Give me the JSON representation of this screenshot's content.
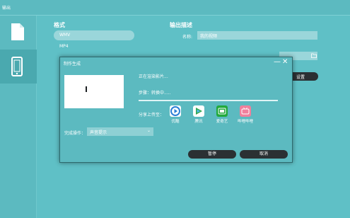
{
  "window": {
    "title": "输出"
  },
  "sidebar": {
    "items": [
      {
        "icon": "document-icon",
        "active": false
      },
      {
        "icon": "phone-icon",
        "active": true
      }
    ]
  },
  "format": {
    "title": "格式",
    "selected": "WMV",
    "options": [
      "WMV",
      "MP4"
    ]
  },
  "description": {
    "title": "输出描述",
    "name_label": "名称:",
    "name_value": "我的视频"
  },
  "settings_button": "设置",
  "dialog": {
    "title": "制作生成",
    "status_rendering": "正在渲染影片...",
    "status_step": "步骤：转换中.....",
    "share_label": "分享上传至：",
    "share_targets": [
      {
        "label": "优酷",
        "icon": "youku-icon",
        "color": "#2b7fd6"
      },
      {
        "label": "腾讯",
        "icon": "tencent-video-icon",
        "color": "#30a84b"
      },
      {
        "label": "爱奇艺",
        "icon": "iqiyi-icon",
        "color": "#22a93c"
      },
      {
        "label": "哔哩哔哩",
        "icon": "bilibili-icon",
        "color": "#f0809c"
      }
    ],
    "complete_label": "完成操作：",
    "complete_value": "声音提示",
    "pause_button": "暂停",
    "cancel_button": "取消"
  },
  "colors": {
    "background": "#5fc0c6",
    "panel": "#5cbac0",
    "dark_button": "#2b3033"
  }
}
